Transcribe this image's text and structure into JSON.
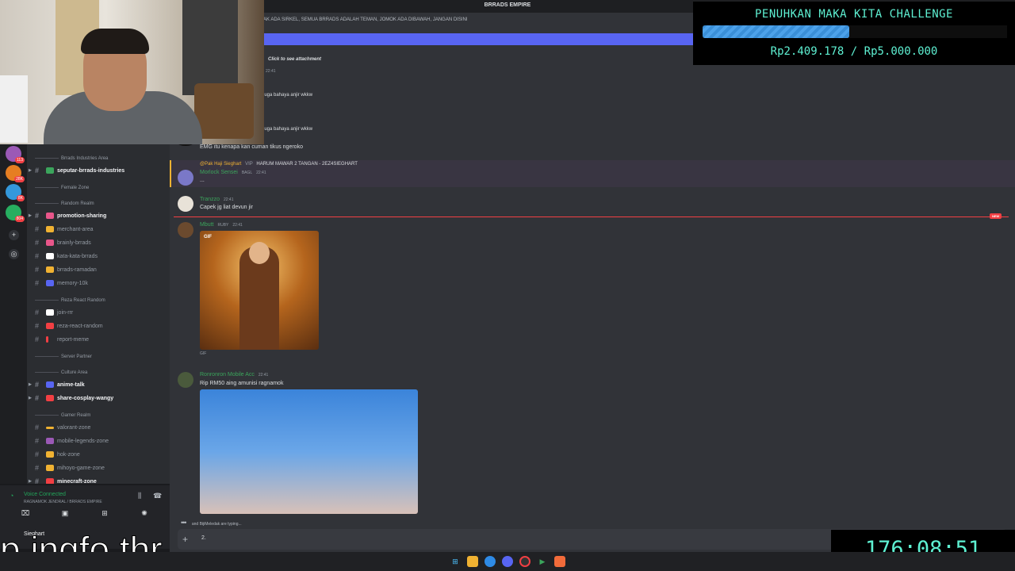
{
  "window": {
    "title": "BRRADS EMPIRE"
  },
  "server_badges": [
    "113",
    "28K",
    "8K",
    "804"
  ],
  "sidebar": {
    "items": [
      {
        "type": "category",
        "label": "Brrads Industries Area"
      },
      {
        "type": "channel",
        "label": "seputar-brrads-industries",
        "unread": true,
        "color": "#3ba55c"
      },
      {
        "type": "category",
        "label": "Female Zone"
      },
      {
        "type": "category",
        "label": "Random Realm"
      },
      {
        "type": "channel",
        "label": "promotion-sharing",
        "unread": true,
        "color": "#e8568a"
      },
      {
        "type": "channel",
        "label": "merchant-area",
        "unread": false,
        "color": "#f0b232"
      },
      {
        "type": "channel",
        "label": "brainly-brrads",
        "unread": false,
        "color": "#e8568a"
      },
      {
        "type": "channel",
        "label": "kata-kata-brrads",
        "unread": false,
        "color": "#ffffff"
      },
      {
        "type": "channel",
        "label": "brrads-ramadan",
        "unread": false,
        "color": "#f0b232"
      },
      {
        "type": "channel",
        "label": "memory-10k",
        "unread": false,
        "color": "#5865f2"
      },
      {
        "type": "category",
        "label": "Reza React Random"
      },
      {
        "type": "channel",
        "label": "join-rrr",
        "unread": false,
        "color": "#ffffff"
      },
      {
        "type": "channel",
        "label": "reza-react-random",
        "unread": false,
        "color": "#f23f43"
      },
      {
        "type": "channel",
        "label": "report-meme",
        "unread": false,
        "color": "#f23f43"
      },
      {
        "type": "category",
        "label": "Server Partner"
      },
      {
        "type": "category",
        "label": "Culture Area"
      },
      {
        "type": "channel",
        "label": "anime-talk",
        "unread": true,
        "color": "#5865f2"
      },
      {
        "type": "channel",
        "label": "share-cosplay-wangy",
        "unread": true,
        "color": "#f23f43"
      },
      {
        "type": "category",
        "label": "Gamer Realm"
      },
      {
        "type": "channel",
        "label": "valorant-zone",
        "unread": false,
        "color": "#f0b232"
      },
      {
        "type": "channel",
        "label": "mobile-legends-zone",
        "unread": false,
        "color": "#9b59b6"
      },
      {
        "type": "channel",
        "label": "hok-zone",
        "unread": false,
        "color": "#f0b232"
      },
      {
        "type": "channel",
        "label": "mihoyo-game-zone",
        "unread": false,
        "color": "#f0b232"
      },
      {
        "type": "channel",
        "label": "minecraft-zone",
        "unread": true,
        "color": "#f23f43"
      }
    ]
  },
  "voice": {
    "status": "Voice Connected",
    "channel": "RAGNAMOK JENDRAL / BRRADS EMPIRE"
  },
  "user": {
    "name": "Sieghart"
  },
  "chat": {
    "topic": "AK ADA SIRKEL, SEMUA BRRADS ADALAH TEMAN, JOMOK ADA DIBAWAH, JANGAN DISINI",
    "attachment_text": "Click to see attachment",
    "messages": [
      {
        "author": "",
        "time": "22:41",
        "text": "juga bahaya anjir wkkw"
      },
      {
        "author": "",
        "time": "",
        "text": "juga bahaya anjir wkkw"
      },
      {
        "author": "",
        "time": "",
        "text": "EMG itu kenapa kan cuman tikus ngeroko"
      },
      {
        "author": "Morlock Sensei",
        "role": "BAGL",
        "time": "22:41",
        "text": "...",
        "reply_author": "@Pak Haji Sieghart",
        "reply_role": "VIP",
        "reply_text": "HARUM MAWAR 2 TANGAN - 2EZ4SIEGHART"
      },
      {
        "author": "Tranzzo",
        "time": "22:41",
        "text": "Capek jg liat devun jir"
      },
      {
        "author": "Mbutt",
        "role": "RUBY",
        "time": "22:41",
        "text": ""
      },
      {
        "author": "Ronronron Mobile Acc",
        "time": "22:41",
        "text": "Rip RM50 aing amunisi ragnamok"
      }
    ],
    "new_label": "NEW",
    "gif_label": "GIF",
    "typing": "and BijiMeledak are typing...",
    "composer_value": "2."
  },
  "overlay": {
    "challenge_title": "PENUHKAN MAKA KITA CHALLENGE",
    "progress_fraction": 0.4818,
    "amount": "Rp2.409.178 / Rp5.000.000",
    "timer": "176:08:51",
    "caption": "p ingfo thr"
  },
  "colors": {
    "accent": "#5ef0d2",
    "progress": "#3a8fd8",
    "discord_blurple": "#5865f2"
  }
}
